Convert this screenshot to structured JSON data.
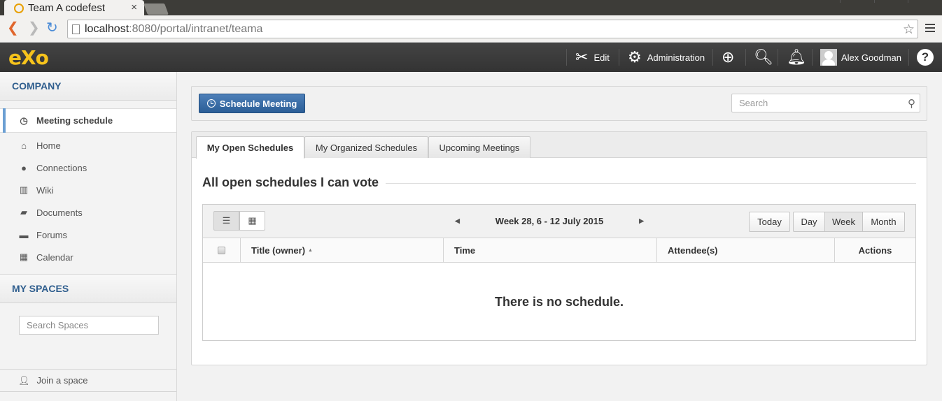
{
  "browser": {
    "tab_title": "Team A codefest",
    "tab_close": "×",
    "url_host": "localhost",
    "url_rest": ":8080/portal/intranet/teama"
  },
  "topbar": {
    "logo": "eXo",
    "edit_label": "Edit",
    "admin_label": "Administration",
    "user_name": "Alex Goodman",
    "help_label": "?"
  },
  "sidebar": {
    "company_header": "COMPANY",
    "items": [
      {
        "label": "Meeting schedule",
        "icon": "clock-icon"
      },
      {
        "label": "Home",
        "icon": "home-icon"
      },
      {
        "label": "Connections",
        "icon": "user-icon"
      },
      {
        "label": "Wiki",
        "icon": "book-icon"
      },
      {
        "label": "Documents",
        "icon": "folder-icon"
      },
      {
        "label": "Forums",
        "icon": "chat-icon"
      },
      {
        "label": "Calendar",
        "icon": "calendar-icon"
      }
    ],
    "spaces_header": "MY SPACES",
    "search_spaces_placeholder": "Search Spaces",
    "join_space": "Join a space"
  },
  "main": {
    "schedule_button": "Schedule Meeting",
    "search_placeholder": "Search",
    "tabs": [
      {
        "label": "My Open Schedules",
        "active": true
      },
      {
        "label": "My Organized Schedules",
        "active": false
      },
      {
        "label": "Upcoming Meetings",
        "active": false
      }
    ],
    "heading": "All open schedules I can vote",
    "week_label": "Week 28, 6 - 12 July 2015",
    "today_button": "Today",
    "day_button": "Day",
    "week_button": "Week",
    "month_button": "Month",
    "selected_view": "Week",
    "columns": [
      "Title (owner)",
      "Time",
      "Attendee(s)",
      "Actions"
    ],
    "sort_indicator": "▲",
    "empty_message": "There is no schedule."
  },
  "colors": {
    "accent": "#2b5e97",
    "topbar": "#3a3a3a",
    "logo": "#f6c31c",
    "sidebar_header": "#2f5e8e"
  }
}
